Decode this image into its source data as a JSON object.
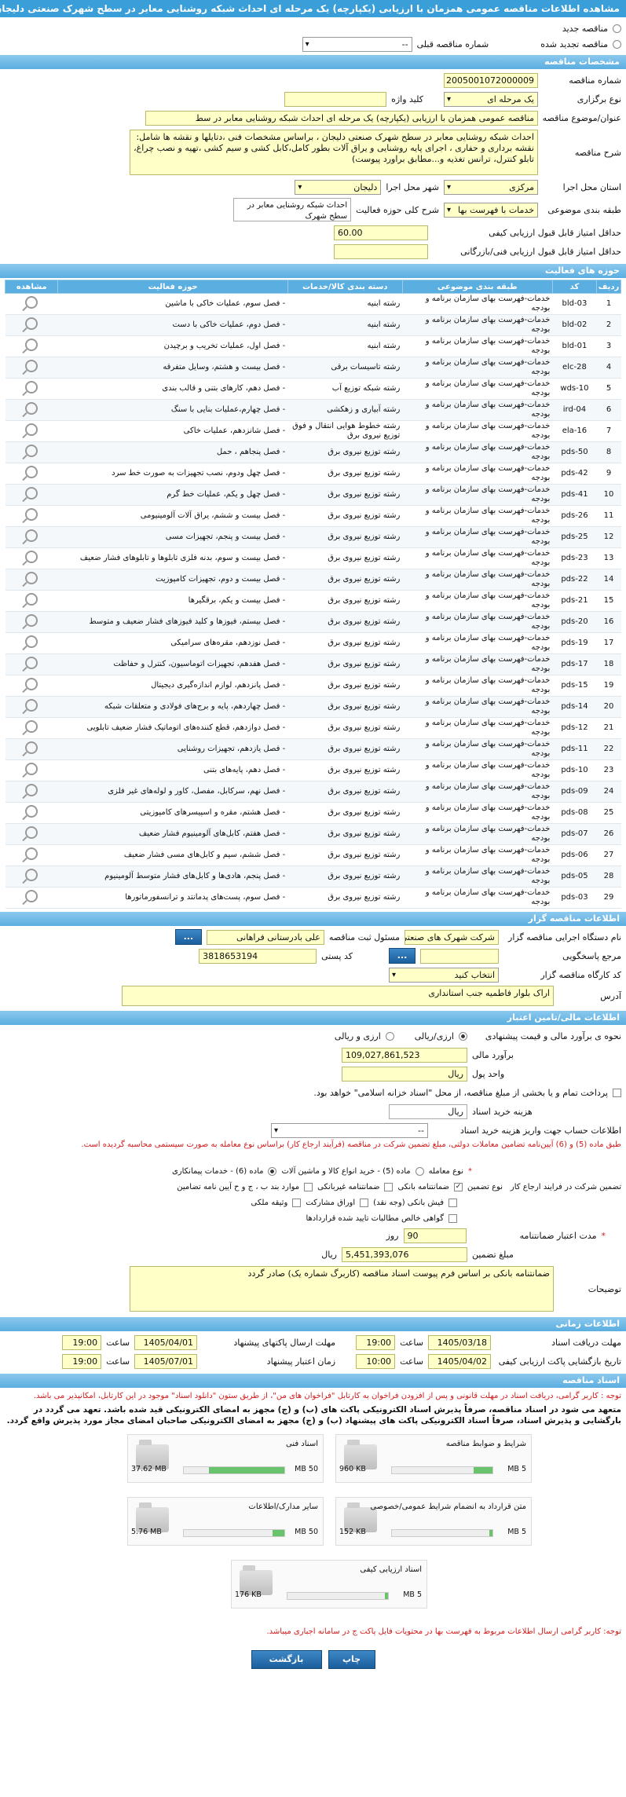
{
  "header": {
    "title": "مشاهده اطلاعات مناقصه عمومی همزمان با ارزیابی (یکپارچه) یک مرحله ای احداث شبکه روشنایی معابر در سطح شهرک صنعتی دلیجان"
  },
  "top": {
    "new_tender": "مناقصه جدید",
    "renewed_tender": "مناقصه تجدید شده",
    "prev_tender_label": "شماره مناقصه قبلی",
    "prev_tender_value": "--"
  },
  "spec": {
    "section": "مشخصات مناقصه",
    "number_label": "شماره مناقصه",
    "number": "2005001072000009",
    "type_label": "نوع برگزاری",
    "type": "یک مرحله ای",
    "keyword_label": "کلید واژه",
    "subject_label": "عنوان/موضوع مناقصه",
    "subject": "مناقصه عمومی همزمان با ارزیابی (یکپارچه) یک مرحله ای احداث شبکه روشنایی معابر در سط",
    "desc_label": "شرح مناقصه",
    "desc": "احداث شبکه روشنایی معابر در سطح شهرک صنعتی دلیجان ، براساس مشخصات فنی ،دتایلها و نقشه ها شامل: نقشه برداری و حفاری ، اجرای پایه روشنایی و یراق آلات بطور کامل،کابل کشی و سیم کشی ،تهیه و نصب چراغ، تابلو کنترل، ترانس تغذیه و...مطابق براورد پیوست)",
    "province_label": "استان محل اجرا",
    "province": "مرکزی",
    "city_label": "شهر محل اجرا",
    "city": "دلیجان",
    "category_label": "طبقه بندی موضوعی",
    "category": "خدمات با فهرست بها",
    "scope_label": "شرح کلی حوزه فعالیت",
    "scope": "احداث شبکه روشنایی معابر در سطح شهرک",
    "min_quality_label": "حداقل امتیاز قابل قبول ارزیابی کیفی",
    "min_quality": "60.00",
    "min_tech_label": "حداقل امتیاز قابل قبول ارزیابی فنی/بازرگانی",
    "min_tech": ""
  },
  "activities": {
    "section": "حوزه های فعالیت",
    "headers": [
      "ردیف",
      "کد",
      "طبقه بندی موضوعی",
      "دسته بندی کالا/خدمات",
      "حوزه فعالیت",
      "مشاهده"
    ],
    "rows": [
      [
        "1",
        "bld-03",
        "خدمات-فهرست بهای سازمان برنامه و بودجه",
        "رشته ابنیه",
        "- فصل سوم، عملیات خاکی با ماشین"
      ],
      [
        "2",
        "bld-02",
        "خدمات-فهرست بهای سازمان برنامه و بودجه",
        "رشته ابنیه",
        "- فصل دوم، عملیات خاکی با دست"
      ],
      [
        "3",
        "bld-01",
        "خدمات-فهرست بهای سازمان برنامه و بودجه",
        "رشته ابنیه",
        "- فصل اول، عملیات تخریب و برچیدن"
      ],
      [
        "4",
        "elc-28",
        "خدمات-فهرست بهای سازمان برنامه و بودجه",
        "رشته تاسیسات برقی",
        "- فصل بیست و هشتم، وسایل متفرقه"
      ],
      [
        "5",
        "wds-10",
        "خدمات-فهرست بهای سازمان برنامه و بودجه",
        "رشته شبکه توزیع آب",
        "- فصل دهم، کارهای بتنی و قالب بندی"
      ],
      [
        "6",
        "ird-04",
        "خدمات-فهرست بهای سازمان برنامه و بودجه",
        "رشته آبیاری و زهکشی",
        "- فصل چهارم،عملیات بنایی با سنگ"
      ],
      [
        "7",
        "ela-16",
        "خدمات-فهرست بهای سازمان برنامه و بودجه",
        "رشته خطوط هوایی انتقال و فوق توزیع نیروی برق",
        "- فصل شانزدهم، عملیات خاکی"
      ],
      [
        "8",
        "pds-50",
        "خدمات-فهرست بهای سازمان برنامه و بودجه",
        "رشته توزیع نیروی برق",
        "- فصل پنجاهم ، حمل"
      ],
      [
        "9",
        "pds-42",
        "خدمات-فهرست بهای سازمان برنامه و بودجه",
        "رشته توزیع نیروی برق",
        "- فصل چهل ودوم، نصب تجهیزات به صورت خط سرد"
      ],
      [
        "10",
        "pds-41",
        "خدمات-فهرست بهای سازمان برنامه و بودجه",
        "رشته توزیع نیروی برق",
        "- فصل چهل و یکم، عملیات خط گرم"
      ],
      [
        "11",
        "pds-26",
        "خدمات-فهرست بهای سازمان برنامه و بودجه",
        "رشته توزیع نیروی برق",
        "- فصل بیست و ششم، یراق آلات آلومینیومی"
      ],
      [
        "12",
        "pds-25",
        "خدمات-فهرست بهای سازمان برنامه و بودجه",
        "رشته توزیع نیروی برق",
        "- فصل بیست و پنجم، تجهیزات مسی"
      ],
      [
        "13",
        "pds-23",
        "خدمات-فهرست بهای سازمان برنامه و بودجه",
        "رشته توزیع نیروی برق",
        "- فصل بیست و سوم، بدنه فلزی تابلوها و تابلوهای فشار ضعیف"
      ],
      [
        "14",
        "pds-22",
        "خدمات-فهرست بهای سازمان برنامه و بودجه",
        "رشته توزیع نیروی برق",
        "- فصل بیست و دوم، تجهیزات کامپوزیت"
      ],
      [
        "15",
        "pds-21",
        "خدمات-فهرست بهای سازمان برنامه و بودجه",
        "رشته توزیع نیروی برق",
        "- فصل بیست و یکم، برقگیرها"
      ],
      [
        "16",
        "pds-20",
        "خدمات-فهرست بهای سازمان برنامه و بودجه",
        "رشته توزیع نیروی برق",
        "- فصل بیستم، فیوزها و کلید فیوزهای فشار ضعیف و متوسط"
      ],
      [
        "17",
        "pds-19",
        "خدمات-فهرست بهای سازمان برنامه و بودجه",
        "رشته توزیع نیروی برق",
        "- فصل نوزدهم، مقره‌های سرامیکی"
      ],
      [
        "18",
        "pds-17",
        "خدمات-فهرست بهای سازمان برنامه و بودجه",
        "رشته توزیع نیروی برق",
        "- فصل هفدهم، تجهیزات اتوماسیون، کنترل و حفاظت"
      ],
      [
        "19",
        "pds-15",
        "خدمات-فهرست بهای سازمان برنامه و بودجه",
        "رشته توزیع نیروی برق",
        "- فصل پانزدهم، لوازم اندازه‌گیری دیجیتال"
      ],
      [
        "20",
        "pds-14",
        "خدمات-فهرست بهای سازمان برنامه و بودجه",
        "رشته توزیع نیروی برق",
        "- فصل چهاردهم، پایه و برج‌های فولادی و متعلقات شبکه"
      ],
      [
        "21",
        "pds-12",
        "خدمات-فهرست بهای سازمان برنامه و بودجه",
        "رشته توزیع نیروی برق",
        "- فصل دوازدهم، قطع کننده‌های اتوماتیک فشار ضعیف تابلویی"
      ],
      [
        "22",
        "pds-11",
        "خدمات-فهرست بهای سازمان برنامه و بودجه",
        "رشته توزیع نیروی برق",
        "- فصل یازدهم، تجهیزات روشنایی"
      ],
      [
        "23",
        "pds-10",
        "خدمات-فهرست بهای سازمان برنامه و بودجه",
        "رشته توزیع نیروی برق",
        "- فصل دهم، پایه‌های بتنی"
      ],
      [
        "24",
        "pds-09",
        "خدمات-فهرست بهای سازمان برنامه و بودجه",
        "رشته توزیع نیروی برق",
        "- فصل نهم، سرکابل، مفصل، کاور و لوله‌های غیر فلزی"
      ],
      [
        "25",
        "pds-08",
        "خدمات-فهرست بهای سازمان برنامه و بودجه",
        "رشته توزیع نیروی برق",
        "- فصل هشتم، مقره و اسپیسرهای کامپوزیتی"
      ],
      [
        "26",
        "pds-07",
        "خدمات-فهرست بهای سازمان برنامه و بودجه",
        "رشته توزیع نیروی برق",
        "- فصل هفتم، کابل‌های آلومینیوم فشار ضعیف"
      ],
      [
        "27",
        "pds-06",
        "خدمات-فهرست بهای سازمان برنامه و بودجه",
        "رشته توزیع نیروی برق",
        "- فصل ششم، سیم و کابل‌های مسی فشار ضعیف"
      ],
      [
        "28",
        "pds-05",
        "خدمات-فهرست بهای سازمان برنامه و بودجه",
        "رشته توزیع نیروی برق",
        "- فصل پنجم، هادی‌ها و کابل‌های فشار متوسط آلومینیوم"
      ],
      [
        "29",
        "pds-03",
        "خدمات-فهرست بهای سازمان برنامه و بودجه",
        "رشته توزیع نیروی برق",
        "- فصل سوم، پست‌های پدمانتد و ترانسفورماتورها"
      ]
    ]
  },
  "org": {
    "section": "اطلاعات مناقصه گزار",
    "exec_label": "نام دستگاه اجرایی مناقصه گزار",
    "exec": "شرکت شهرک های صنعتی",
    "resp_label": "مسئول ثبت مناقصه",
    "resp": "علی بادرستانی فراهانی",
    "ref_label": "مرجع پاسخگویی",
    "postal_label": "کد پستی",
    "postal": "3818653194",
    "workshop_label": "کد کارگاه مناقصه گزار",
    "workshop": "انتخاب کنید",
    "address_label": "آدرس",
    "address": "اراک بلوار فاطمیه جنب استانداری",
    "more": "...",
    "go": "..."
  },
  "finance": {
    "section": "اطلاعات مالی/تامین اعتبار",
    "estimate_type_label": "نحوه ی برآورد مالی و قیمت پیشنهادی",
    "opt_rial": "ارزی/ریالی",
    "opt_fx": "ارزی و ریالی",
    "estimate_label": "برآورد مالی",
    "estimate": "109,027,861,523",
    "unit_label": "واحد پول",
    "unit": "ریال",
    "treasury_text": "پرداخت تمام و یا بخشی از مبلغ مناقصه، از محل \"اسناد خزانه اسلامی\" خواهد بود.",
    "doc_cost_label": "هزینه خرید اسناد",
    "doc_cost_unit": "ریال",
    "account_label": "اطلاعات حساب جهت واریز هزینه خرید اسناد",
    "account": "--",
    "notice": "طبق ماده (5) و (6) آیین‌نامه تضامین معاملات دولتی، مبلغ تضمین شرکت در مناقصه (فرآیند ارجاع کار) براساس نوع معامله به صورت سیستمی محاسبه گردیده است.",
    "deal_type_label": "نوع معامله",
    "deal_opt1": "ماده (5) - خرید انواع کالا و ماشین آلات",
    "deal_opt2": "ماده (6) - خدمات پیمانکاری",
    "guarantee_label": "تضمین شرکت در فرایند ارجاع کار",
    "guarantee_type_label": "نوع تضمین",
    "g1": "ضمانتنامه بانکی",
    "g2": "ضمانتنامه غیربانکی",
    "g3": "موارد بند ب ، ج و ح آیین نامه تضامین",
    "g4": "فیش بانکی (وجه نقد)",
    "g5": "اوراق مشارکت",
    "g6": "وثیقه ملکی",
    "g7": "گواهی خالص مطالبات تایید شده قراردادها",
    "validity_label": "مدت اعتبار ضمانتنامه",
    "validity": "90",
    "validity_unit": "روز",
    "amount_label": "مبلغ تضمین",
    "amount": "5,451,393,076",
    "amount_unit": "ریال",
    "notes_label": "توضیحات",
    "notes": "ضمانتنامه بانکی بر اساس فرم پیوست اسناد مناقصه (کاربرگ شماره یک) صادر گردد"
  },
  "timing": {
    "section": "اطلاعات زمانی",
    "doc_deadline_label": "مهلت دریافت اسناد",
    "doc_deadline_date": "1405/03/18",
    "doc_deadline_time": "19:00",
    "send_deadline_label": "مهلت ارسال پاکتهای پیشنهاد",
    "send_deadline_date": "1405/04/01",
    "send_deadline_time": "19:00",
    "open_label": "تاریخ بازگشایی پاکت ارزیابی کیفی",
    "open_date": "1405/04/02",
    "open_time": "10:00",
    "valid_label": "زمان اعتبار پیشنهاد",
    "valid_date": "1405/07/01",
    "valid_time": "19:00",
    "time_label": "ساعت"
  },
  "docs": {
    "section": "اسناد مناقصه",
    "notice1": "توجه : کاربر گرامی، دریافت اسناد در مهلت قانونی و پس از افزودن فراخوان به کارتابل \"فراخوان های من\"، از طریق ستون \"دانلود اسناد\" موجود در این کارتابل، امکانپذیر می باشد.",
    "notice2": "متعهد می شود در اسناد مناقصه، صرفاً پذیرش اسناد الکترونیکی پاکت های (ب) و (ج) مجهز به امضای الکترونیکی قید شده باشد. تعهد می گردد در بارگشایی و پذیرش اسناد، صرفاً اسناد الکترونیکی پاکت های پیشنهاد (ب) و (ج) مجهز به امضای الکترونیکی صاحبان امضای مجاز مورد پذیرش واقع گردد.",
    "files": [
      {
        "name": "شرایط و ضوابط مناقصه",
        "size": "960 KB",
        "max": "5 MB",
        "pct": 19
      },
      {
        "name": "اسناد فنی",
        "size": "37.62 MB",
        "max": "50 MB",
        "pct": 75
      },
      {
        "name": "متن قرارداد به انضمام شرایط عمومی/خصوصی",
        "size": "152 KB",
        "max": "5 MB",
        "pct": 3
      },
      {
        "name": "سایر مدارک/اطلاعات",
        "size": "5.76 MB",
        "max": "50 MB",
        "pct": 12
      },
      {
        "name": "اسناد ارزیابی کیفی",
        "size": "176 KB",
        "max": "5 MB",
        "pct": 3
      }
    ],
    "notice3": "توجه: کاربر گرامی ارسال اطلاعات مربوط به فهرست بها در محتویات فایل پاکت ج در سامانه اجباری میباشد."
  },
  "actions": {
    "print": "چاپ",
    "back": "بازگشت"
  }
}
